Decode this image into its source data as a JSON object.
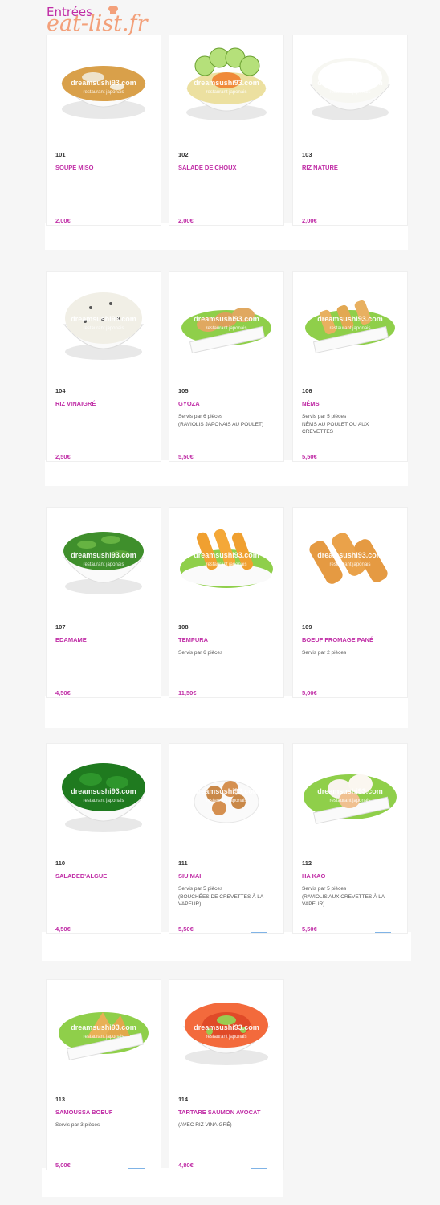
{
  "header": {
    "section_title": "Entrées",
    "logo_text": "eat-list.fr"
  },
  "watermark": {
    "line1": "dreamsushi93.com",
    "line2": "restaurant japonais"
  },
  "products": [
    {
      "number": "101",
      "name": "SOUPE MISO",
      "desc": "",
      "price": "2,00€",
      "image_icon": "miso-soup-bowl"
    },
    {
      "number": "102",
      "name": "SALADE DE CHOUX",
      "desc": "",
      "price": "2,00€",
      "image_icon": "cabbage-salad-bowl"
    },
    {
      "number": "103",
      "name": "RIZ NATURE",
      "desc": "",
      "price": "2,00€",
      "image_icon": "rice-bowl"
    },
    {
      "number": "104",
      "name": "RIZ VINAIGRÉ",
      "desc": "",
      "price": "2,50€",
      "image_icon": "vinegar-rice-bowl"
    },
    {
      "number": "105",
      "name": "GYOZA",
      "desc": "Servis par 6 pièces\n(RAVIOLIS JAPONAIS AU POULET)",
      "price": "5,50€",
      "image_icon": "gyoza-plate"
    },
    {
      "number": "106",
      "name": "NÊMS",
      "desc": "Servis par 5 pièces\nNÊMS AU POULET OU AUX CREVETTES",
      "price": "5,50€",
      "image_icon": "nems-plate"
    },
    {
      "number": "107",
      "name": "EDAMAME",
      "desc": "",
      "price": "4,50€",
      "image_icon": "edamame-bowl"
    },
    {
      "number": "108",
      "name": "TEMPURA",
      "desc": "Servis par 6 pièces",
      "price": "11,50€",
      "image_icon": "tempura-plate"
    },
    {
      "number": "109",
      "name": "BOEUF FROMAGE PANÉ",
      "desc": "Servis par 2 pièces",
      "price": "5,00€",
      "image_icon": "breaded-beef-cheese"
    },
    {
      "number": "110",
      "name": "SALADED'ALGUE",
      "desc": "",
      "price": "4,50€",
      "image_icon": "seaweed-salad-bowl"
    },
    {
      "number": "111",
      "name": "SIU MAI",
      "desc": "Servis par 5 pièces\n(BOUCHÉES DE CREVETTES À LA VAPEUR)",
      "price": "5,50€",
      "image_icon": "siu-mai-plate"
    },
    {
      "number": "112",
      "name": "HA KAO",
      "desc": "Servis par 5 pièces\n(RAVIOLIS AUX CREVETTES À LA VAPEUR)",
      "price": "5,50€",
      "image_icon": "ha-kao-plate"
    },
    {
      "number": "113",
      "name": "SAMOUSSA BOEUF",
      "desc": "Servis par 3 pièces",
      "price": "5,00€",
      "image_icon": "samoussa-plate"
    },
    {
      "number": "114",
      "name": "TARTARE SAUMON AVOCAT",
      "desc": "(AVEC RIZ VINAIGRÉ)",
      "price": "4,80€",
      "image_icon": "salmon-avocado-tartare"
    }
  ]
}
